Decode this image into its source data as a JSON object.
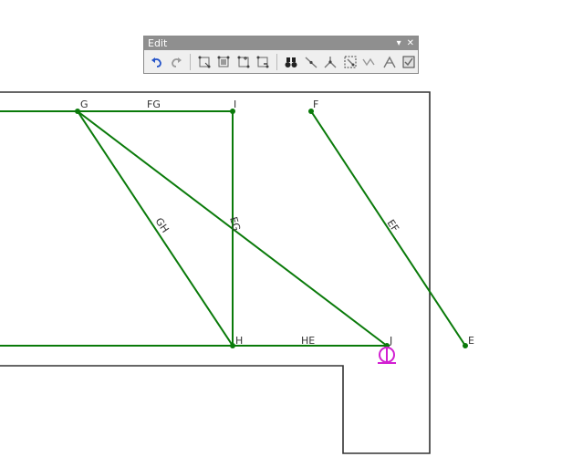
{
  "toolbar": {
    "title": "Edit",
    "buttons": [
      {
        "icon": "undo-icon"
      },
      {
        "icon": "redo-icon"
      },
      {
        "icon": "node-move-icon"
      },
      {
        "icon": "node-select-icon"
      },
      {
        "icon": "node-add-icon"
      },
      {
        "icon": "node-delete-icon"
      },
      {
        "icon": "binoculars-icon"
      },
      {
        "icon": "member-split-icon"
      },
      {
        "icon": "member-connect-icon"
      },
      {
        "icon": "member-select-icon"
      },
      {
        "icon": "member-extend-icon"
      },
      {
        "icon": "member-trim-icon"
      },
      {
        "icon": "member-check-icon"
      }
    ]
  },
  "drawing": {
    "member_color": "#0a7a0a",
    "support_color": "#d21fd2",
    "nodes": [
      "G",
      "I",
      "F",
      "H",
      "J",
      "E"
    ],
    "members": [
      "FG",
      "GH",
      "EG",
      "EF",
      "HE"
    ]
  }
}
